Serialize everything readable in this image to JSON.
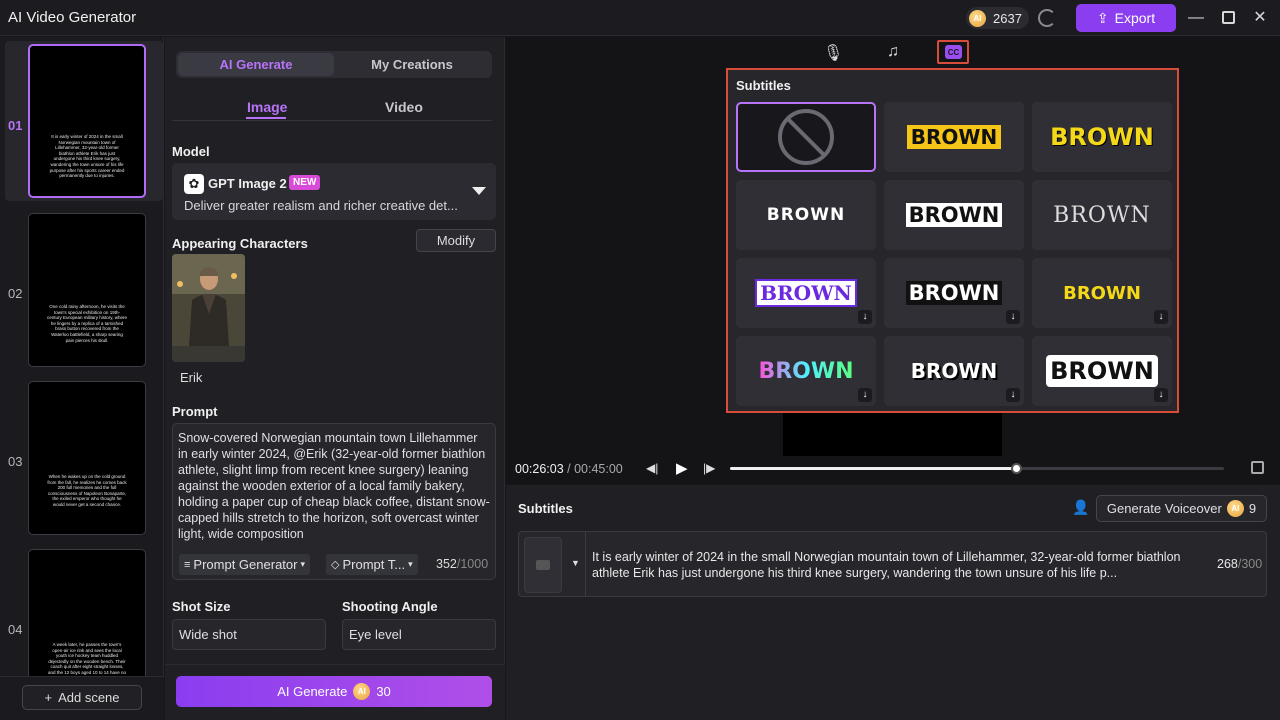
{
  "app": {
    "title": "AI Video Generator",
    "credits": "2637",
    "export_label": "Export",
    "coin_label": "AI"
  },
  "scenes": [
    {
      "num": "01",
      "text": "It is early winter of 2024 in the small Norwegian mountain town of Lillehammer, 32-year-old former biathlon athlete Erik has just undergone his third knee surgery, wandering the town unsure of his life purpose after his sports career ended permanently due to injuries."
    },
    {
      "num": "02",
      "text": "One cold rainy afternoon, he visits the town's special exhibition on 19th-century European military history, where he lingers by a replica of a tarnished brass button recovered from the Waterloo battlefield, a sharp searing pain pierces his skull."
    },
    {
      "num": "03",
      "text": "When he wakes up on the cold ground from the fall, he realizes he comes back 200 full memories and the full consciousness of Napoleon Bonaparte, the exiled emperor who thought he would never get a second chance."
    },
    {
      "num": "04",
      "text": "A week later, he passes the town's open-air ice rink and sees the local youth ice hockey team huddled dejectedly on the wooden bench. Their coach quit after eight straight losses, and the 12 boys aged 10 to 14 have no one to lead them."
    }
  ],
  "add_scene_label": "Add scene",
  "tabs": {
    "ai_generate": "AI Generate",
    "my_creations": "My Creations",
    "image": "Image",
    "video": "Video"
  },
  "model": {
    "section": "Model",
    "name": "GPT Image 2",
    "badge": "NEW",
    "desc": "Deliver greater realism and richer creative det..."
  },
  "characters": {
    "section": "Appearing Characters",
    "modify_label": "Modify",
    "name": "Erik"
  },
  "prompt": {
    "section": "Prompt",
    "text": "Snow-covered Norwegian mountain town Lillehammer in early winter 2024, @Erik (32-year-old former biathlon athlete, slight limp from recent knee surgery) leaning against the wooden exterior of a local family bakery, holding a paper cup of cheap black coffee, distant snow-capped hills stretch to the horizon, soft overcast winter light, wide composition",
    "generator_label": "Prompt Generator",
    "template_label": "Prompt T...",
    "count": "352",
    "max": "/1000"
  },
  "shot": {
    "size_label": "Shot Size",
    "size_value": "Wide shot",
    "angle_label": "Shooting Angle",
    "angle_value": "Eye level"
  },
  "generate": {
    "label": "AI Generate",
    "cost": "30"
  },
  "subtitles_popup": {
    "title": "Subtitles",
    "styles": [
      "none",
      "yellow-box",
      "yellow-plain",
      "white-outline",
      "white-heavy",
      "serif-gray",
      "blue-box",
      "heavy-round",
      "yellow-bold",
      "gradient",
      "white-bold",
      "black-box"
    ],
    "sample_word": "BROWN"
  },
  "player": {
    "current": "00:26:03",
    "total": " / 00:45:00",
    "progress": 0.58
  },
  "subtitles_panel": {
    "title": "Subtitles",
    "voiceover_label": "Generate Voiceover",
    "voiceover_cost": "9",
    "text": "It is early winter of 2024 in the small Norwegian mountain town of Lillehammer, 32-year-old former biathlon athlete Erik has just undergone his third knee surgery, wandering the town unsure of his life p...",
    "count": "268",
    "max": "/300"
  }
}
